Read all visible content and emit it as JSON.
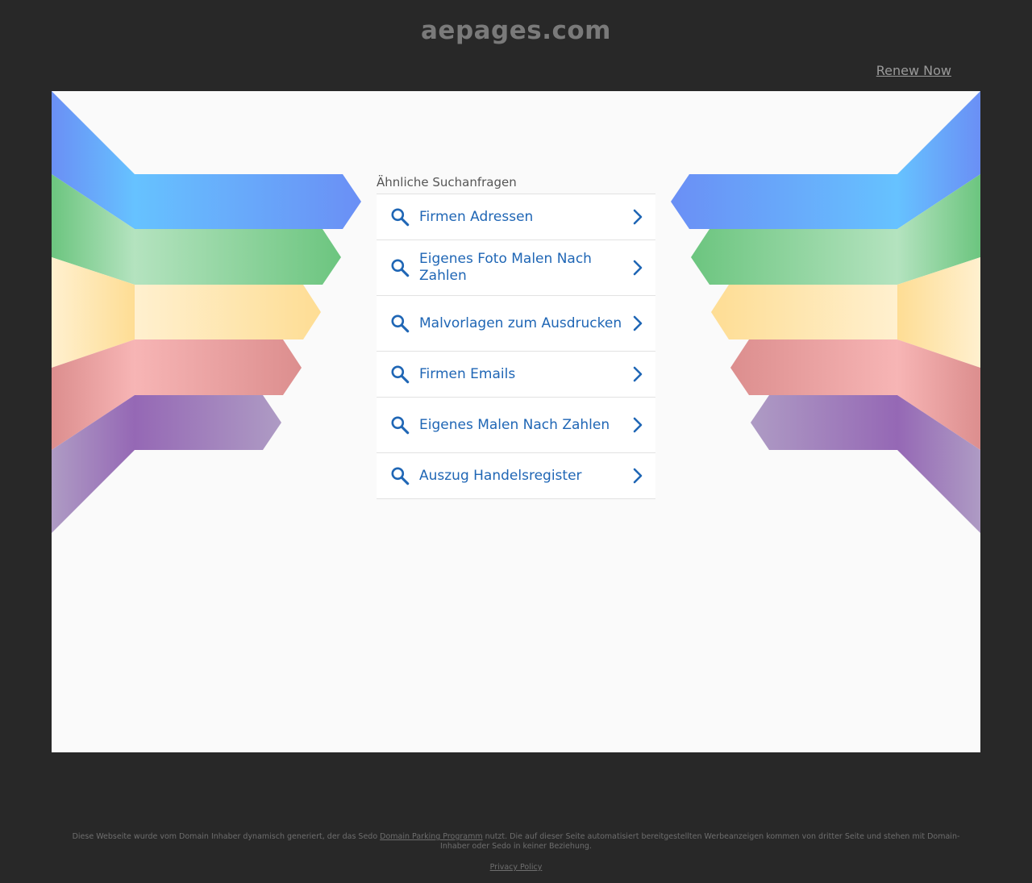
{
  "header": {
    "domain": "aepages.com",
    "renew_label": "Renew Now"
  },
  "search": {
    "heading": "Ähnliche Suchanfragen",
    "items": [
      {
        "label": "Firmen Adressen"
      },
      {
        "label": "Eigenes Foto Malen Nach Zahlen"
      },
      {
        "label": "Malvorlagen zum Ausdrucken"
      },
      {
        "label": "Firmen Emails"
      },
      {
        "label": "Eigenes Malen Nach Zahlen"
      },
      {
        "label": "Auszug Handelsregister"
      }
    ]
  },
  "footer": {
    "text_before": "Diese Webseite wurde vom Domain Inhaber dynamisch generiert, der das Sedo ",
    "link_label": "Domain Parking Programm",
    "text_after": " nutzt. Die auf dieser Seite automatisiert bereitgestellten Werbeanzeigen kommen von dritter Seite und stehen mit Domain-Inhaber oder Sedo in keiner Beziehung.",
    "privacy_label": "Privacy Policy"
  },
  "colors": {
    "background": "#282828",
    "panel": "#fafafa",
    "link_blue": "#1f66b5",
    "ribbon_blue": "#66aaff",
    "ribbon_green": "#7ccf8c",
    "ribbon_yellow": "#fde5a6",
    "ribbon_red": "#e8a3a3",
    "ribbon_purple": "#a07fbf"
  }
}
